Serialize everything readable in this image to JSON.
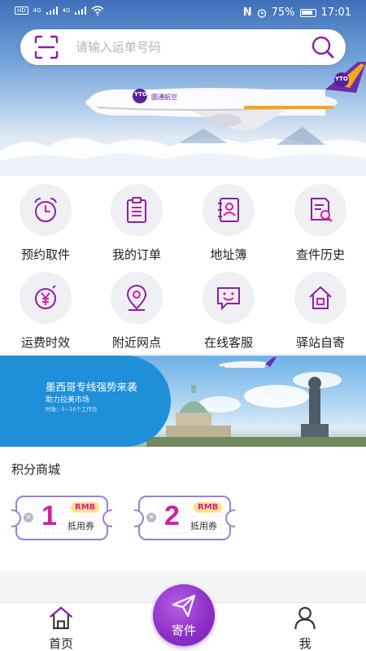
{
  "status_bar": {
    "left_badges": [
      "HD",
      "4G",
      "4G"
    ],
    "battery": "75%",
    "time": "17:01"
  },
  "search": {
    "placeholder": "请输入运单号码"
  },
  "hero": {
    "aircraft_brand": "圆通航空",
    "logo_text": "YTO"
  },
  "services": [
    {
      "label": "预约取件",
      "icon": "alarm-clock-icon"
    },
    {
      "label": "我的订单",
      "icon": "clipboard-list-icon"
    },
    {
      "label": "地址簿",
      "icon": "address-book-icon"
    },
    {
      "label": "查件历史",
      "icon": "document-search-icon"
    },
    {
      "label": "运费时效",
      "icon": "yen-timer-icon"
    },
    {
      "label": "附近网点",
      "icon": "location-pin-icon"
    },
    {
      "label": "在线客服",
      "icon": "chat-smile-icon"
    },
    {
      "label": "驿站自寄",
      "icon": "house-icon"
    }
  ],
  "promo": {
    "title": "墨西哥专线强势来袭",
    "subtitle": "助力拉美市场",
    "note": "时效：5~10个工作日"
  },
  "mall": {
    "heading": "积分商城",
    "coupons": [
      {
        "amount": "1",
        "currency": "RMB",
        "desc": "抵用券"
      },
      {
        "amount": "2",
        "currency": "RMB",
        "desc": "抵用券"
      }
    ]
  },
  "tabbar": {
    "home": "首页",
    "send": "寄件",
    "me": "我"
  },
  "colors": {
    "accent": "#8a2fc6",
    "coupon_red": "#d21fa0",
    "icon_purple": "#8b1fa8"
  }
}
